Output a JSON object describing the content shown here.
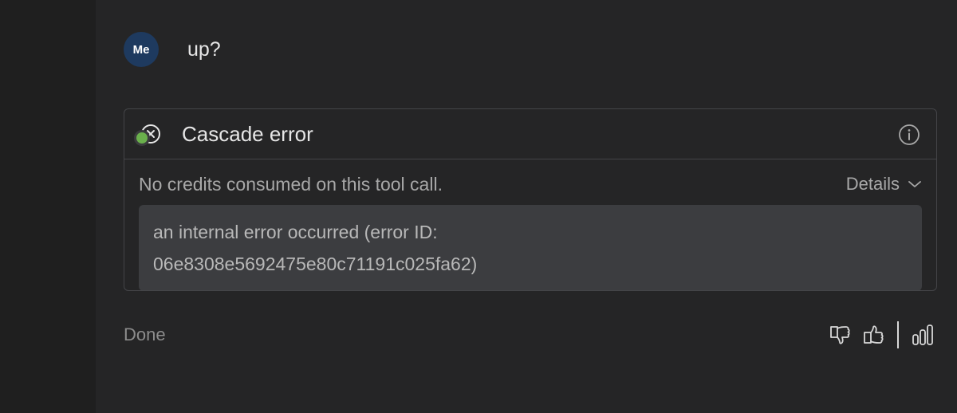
{
  "user": {
    "avatar_initials": "Me",
    "message": "up?"
  },
  "error_card": {
    "title": "Cascade error",
    "icon": "close-circle-icon",
    "info_icon": "info-icon",
    "credits_note": "No credits consumed on this tool call.",
    "details_label": "Details",
    "error_line1": "an internal error occurred (error ID:",
    "error_line2": "06e8308e5692475e80c71191c025fa62)"
  },
  "footer": {
    "status": "Done",
    "actions": [
      "thumbs-down-icon",
      "thumbs-up-icon",
      "bar-chart-icon"
    ]
  },
  "colors": {
    "background": "#252526",
    "avatar_bg": "#1e3a5f",
    "status_dot": "#6ab04c",
    "card_border": "#444548",
    "message_bg": "#3c3d40"
  }
}
